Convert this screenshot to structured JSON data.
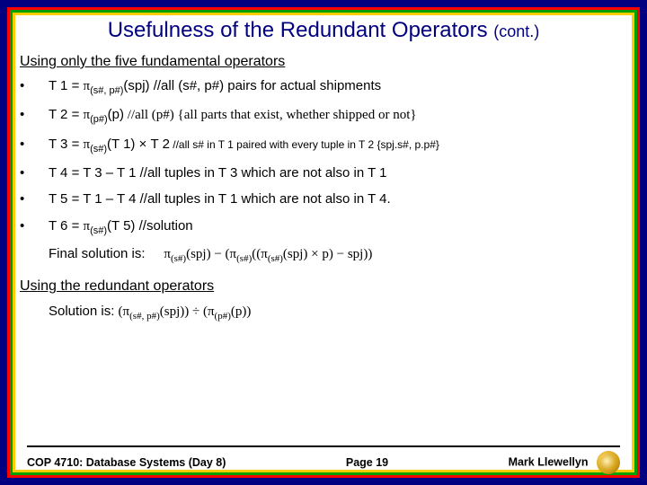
{
  "title_main": "Usefulness of the Redundant Operators",
  "title_cont": "(cont.)",
  "heading1": "Using only the five fundamental operators",
  "rows": [
    {
      "b": "•",
      "lhs": "T 1 = ",
      "proj": "π",
      "sub": "(s#, p#)",
      "arg": "(spj)",
      "cmt": "   //all (s#, p#) pairs for actual shipments",
      "cmtSerif": false
    },
    {
      "b": "•",
      "lhs": "T 2 = ",
      "proj": "π",
      "sub": "(p#)",
      "arg": "(p)",
      "cmt": "  //all (p#)  {all parts that exist, whether shipped or not}",
      "cmtSerif": true
    },
    {
      "b": "•",
      "lhs": "T 3 = ",
      "proj": "π",
      "sub": "(s#)",
      "arg": "(T 1) × T 2",
      "cmt": " //all s# in T 1 paired with every tuple in T 2  {spj.s#, p.p#}",
      "cmtSerif": false,
      "cmtSmall": true
    },
    {
      "b": "•",
      "lhs": "T 4 = T 3 – T 1",
      "proj": "",
      "sub": "",
      "arg": "",
      "cmt": " //all tuples in T 3 which are not also in T 1",
      "cmtSerif": false
    },
    {
      "b": "•",
      "lhs": "T 5 = T 1 – T 4",
      "proj": "",
      "sub": "",
      "arg": "",
      "cmt": " //all tuples in T 1 which are not also in T 4.",
      "cmtSerif": false
    },
    {
      "b": "•",
      "lhs": "T 6 = ",
      "proj": "π",
      "sub": "(s#)",
      "arg": "(T 5)",
      "cmt": "  //solution",
      "cmtSerif": false
    }
  ],
  "final_label": "Final solution is:",
  "final_expr_html": "π<span class='sub'>(s#)</span>(spj) − (π<span class='sub'>(s#)</span>((π<span class='sub'>(s#)</span>(spj) × p) − spj))",
  "heading2": "Using the redundant operators",
  "sol_label": "Solution is:  ",
  "sol_expr_html": "(π<span class='sub'>(s#, p#)</span>(spj)) ÷ (π<span class='sub'>(p#)</span>(p))",
  "footer": {
    "left": "COP 4710: Database Systems  (Day 8)",
    "mid": "Page 19",
    "right": "Mark Llewellyn"
  }
}
